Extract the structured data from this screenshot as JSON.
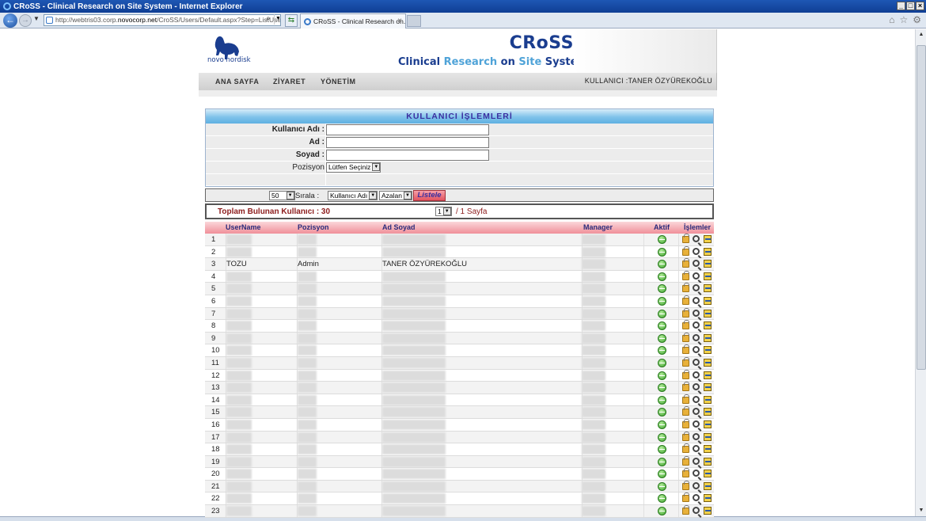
{
  "browser": {
    "title": "CRoSS - Clinical Research on Site System - Internet Explorer",
    "address": "http://webtris03.corp.",
    "address_domain": "novocorp.net",
    "address_path": "/CroSS/Users/Default.aspx?Step=ListUsers",
    "tab_title": "CRoSS - Clinical Research on..."
  },
  "header": {
    "logo_text": "novo nordisk",
    "brand": "CRoSS",
    "subtitle_1": "Clinical ",
    "subtitle_2": "Research",
    "subtitle_3": " on ",
    "subtitle_4": "Site",
    "subtitle_5": " System"
  },
  "menu": {
    "items": [
      "ANA SAYFA",
      "ZİYARET",
      "YÖNETİM"
    ],
    "user": "KULLANICI :TANER ÖZYÜREKOĞLU"
  },
  "panel": {
    "title": "KULLANICI   İŞLEMLERİ",
    "username_label": "Kullanıcı Adı :",
    "name_label": "Ad :",
    "surname_label": "Soyad :",
    "position_label": "Pozisyon",
    "position_value": "Lütfen Seçiniz"
  },
  "sort": {
    "page_size": "50",
    "label": "Sırala :",
    "field": "Kullanıcı Adı",
    "order": "Azalan",
    "button": "Listele"
  },
  "total": {
    "label": "Toplam Bulunan Kullanıcı : 30",
    "page": "1",
    "pages": "/ 1 Sayfa"
  },
  "grid": {
    "headers": [
      "UserName",
      "Pozisyon",
      "Ad Soyad",
      "Manager",
      "Aktif",
      "İşlemler"
    ],
    "rows": [
      {
        "n": "1",
        "user": "",
        "pos": "",
        "name": ""
      },
      {
        "n": "2",
        "user": "",
        "pos": "",
        "name": ""
      },
      {
        "n": "3",
        "user": "TOZU",
        "pos": "Admin",
        "name": "TANER ÖZYÜREKOĞLU"
      },
      {
        "n": "4",
        "user": "",
        "pos": "",
        "name": ""
      },
      {
        "n": "5",
        "user": "",
        "pos": "",
        "name": ""
      },
      {
        "n": "6",
        "user": "",
        "pos": "",
        "name": ""
      },
      {
        "n": "7",
        "user": "",
        "pos": "",
        "name": ""
      },
      {
        "n": "8",
        "user": "",
        "pos": "",
        "name": ""
      },
      {
        "n": "9",
        "user": "",
        "pos": "",
        "name": ""
      },
      {
        "n": "10",
        "user": "",
        "pos": "",
        "name": ""
      },
      {
        "n": "11",
        "user": "",
        "pos": "",
        "name": ""
      },
      {
        "n": "12",
        "user": "",
        "pos": "",
        "name": ""
      },
      {
        "n": "13",
        "user": "",
        "pos": "",
        "name": ""
      },
      {
        "n": "14",
        "user": "",
        "pos": "",
        "name": ""
      },
      {
        "n": "15",
        "user": "",
        "pos": "",
        "name": ""
      },
      {
        "n": "16",
        "user": "",
        "pos": "",
        "name": ""
      },
      {
        "n": "17",
        "user": "",
        "pos": "",
        "name": ""
      },
      {
        "n": "18",
        "user": "",
        "pos": "",
        "name": ""
      },
      {
        "n": "19",
        "user": "",
        "pos": "",
        "name": ""
      },
      {
        "n": "20",
        "user": "",
        "pos": "",
        "name": ""
      },
      {
        "n": "21",
        "user": "",
        "pos": "",
        "name": ""
      },
      {
        "n": "22",
        "user": "",
        "pos": "",
        "name": ""
      },
      {
        "n": "23",
        "user": "",
        "pos": "",
        "name": ""
      }
    ]
  }
}
